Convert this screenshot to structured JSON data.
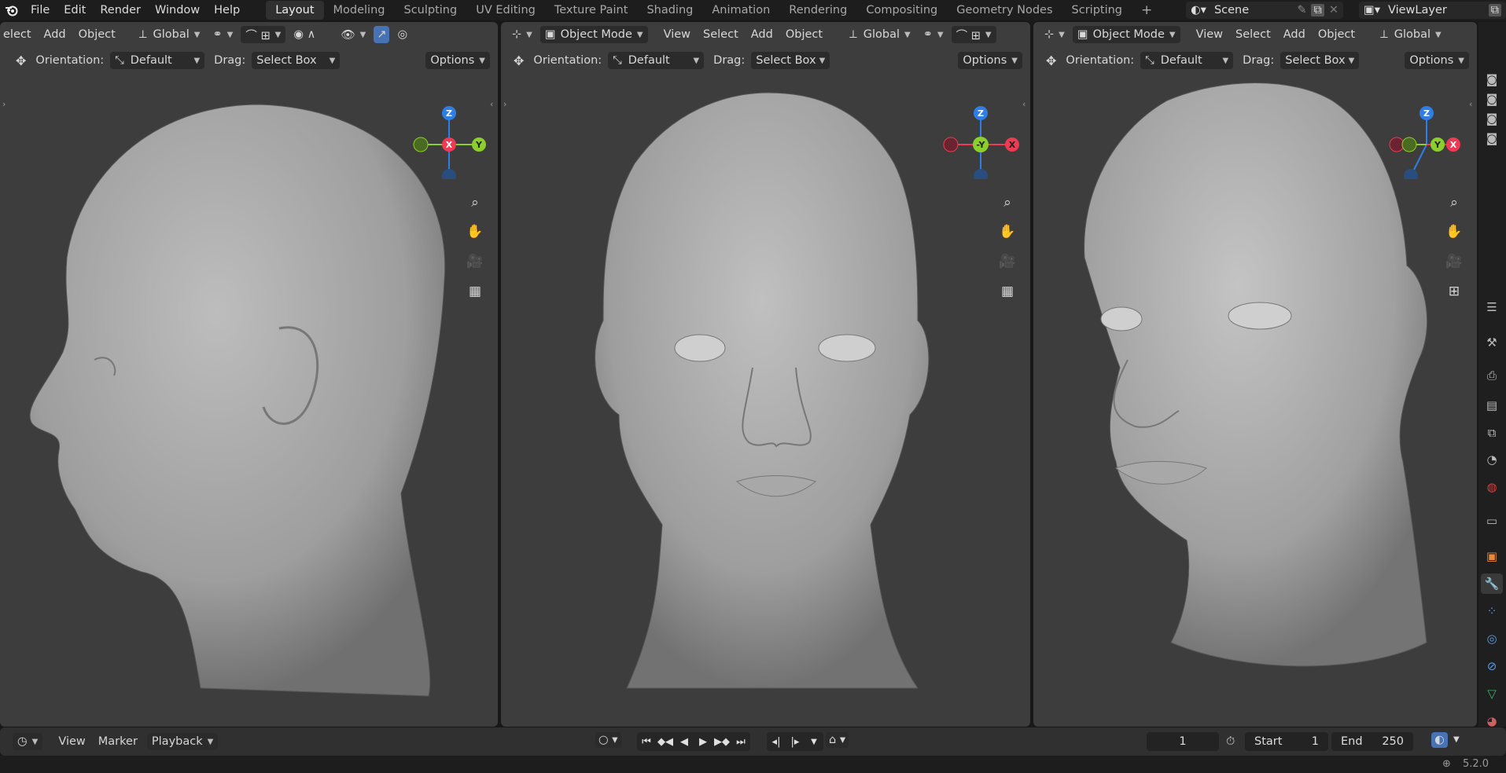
{
  "topbar": {
    "menus": [
      "File",
      "Edit",
      "Render",
      "Window",
      "Help"
    ],
    "workspaces": [
      "Layout",
      "Modeling",
      "Sculpting",
      "UV Editing",
      "Texture Paint",
      "Shading",
      "Animation",
      "Rendering",
      "Compositing",
      "Geometry Nodes",
      "Scripting"
    ],
    "active_workspace": "Layout",
    "scene_name": "Scene",
    "viewlayer_name": "ViewLayer"
  },
  "viewports": [
    {
      "header_items": [
        "elect",
        "Add",
        "Object"
      ],
      "transform": "Global",
      "orientation_label": "Orientation:",
      "orientation_value": "Default",
      "drag_label": "Drag:",
      "drag_value": "Select Box",
      "options_label": "Options",
      "gizmo": {
        "center": "X",
        "left": "",
        "right": "Y",
        "top": "Z"
      }
    },
    {
      "mode": "Object Mode",
      "header_items": [
        "View",
        "Select",
        "Add",
        "Object"
      ],
      "transform": "Global",
      "orientation_label": "Orientation:",
      "orientation_value": "Default",
      "drag_label": "Drag:",
      "drag_value": "Select Box",
      "options_label": "Options",
      "gizmo": {
        "center": "-Y",
        "left": "",
        "right": "X",
        "top": "Z"
      }
    },
    {
      "mode": "Object Mode",
      "header_items": [
        "View",
        "Select",
        "Add",
        "Object"
      ],
      "transform": "Global",
      "orientation_label": "Orientation:",
      "orientation_value": "Default",
      "drag_label": "Drag:",
      "drag_value": "Select Box",
      "options_label": "Options",
      "gizmo": {
        "center": "Y",
        "left": "",
        "right": "X",
        "top": "Z"
      }
    }
  ],
  "timeline": {
    "menus": [
      "View",
      "Marker",
      "Playback"
    ],
    "current_frame": "1",
    "start_label": "Start",
    "start_value": "1",
    "end_label": "End",
    "end_value": "250"
  },
  "statusbar": {
    "version": "5.2.0"
  },
  "colors": {
    "axis_x": "#ee3a52",
    "axis_y": "#8bd02a",
    "axis_z": "#2e7ee6",
    "accent": "#4772b3",
    "bg_viewport": "#3d3d3d"
  }
}
